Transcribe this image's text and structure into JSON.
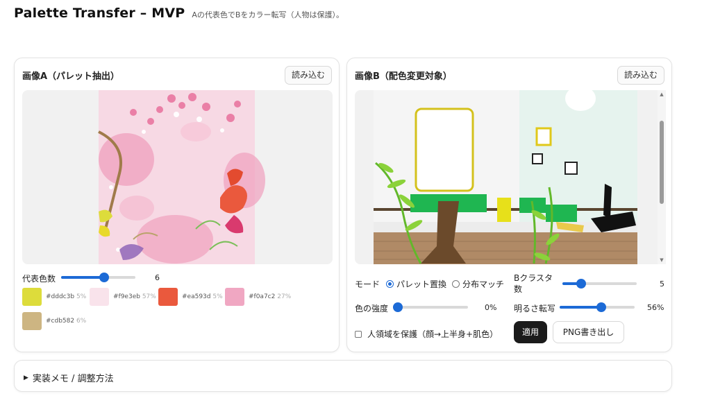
{
  "header": {
    "title": "Palette Transfer – MVP",
    "subtitle": "Aの代表色でBをカラー転写（人物は保護）。"
  },
  "panel_a": {
    "title": "画像A（パレット抽出）",
    "load_button": "読み込む",
    "colors_label": "代表色数",
    "colors_value": "6",
    "colors_fraction": 0.58,
    "palette": [
      {
        "hex": "#dddc3b",
        "pct": "5%"
      },
      {
        "hex": "#f9e3eb",
        "pct": "57%"
      },
      {
        "hex": "#ea593d",
        "pct": "5%"
      },
      {
        "hex": "#f0a7c2",
        "pct": "27%"
      },
      {
        "hex": "#cdb582",
        "pct": "6%"
      }
    ]
  },
  "panel_b": {
    "title": "画像B（配色変更対象）",
    "load_button": "読み込む",
    "mode_label": "モード",
    "mode_options": [
      "パレット置換",
      "分布マッチ"
    ],
    "mode_selected": "パレット置換",
    "clusters_label": "Bクラスタ数",
    "clusters_value": "5",
    "clusters_fraction": 0.25,
    "strength_label": "色の強度",
    "strength_value": "0%",
    "strength_fraction": 0.0,
    "brightness_label": "明るさ転写",
    "brightness_value": "56%",
    "brightness_fraction": 0.56,
    "protect_label": "人領域を保護（顔→上半身+肌色）",
    "protect_checked": false,
    "apply_button": "適用",
    "export_button": "PNG書き出し"
  },
  "notes": {
    "summary": "実装メモ / 調整方法"
  },
  "colors": {
    "accent": "#1c6ad6",
    "apply_bg": "#1b1b1b"
  }
}
